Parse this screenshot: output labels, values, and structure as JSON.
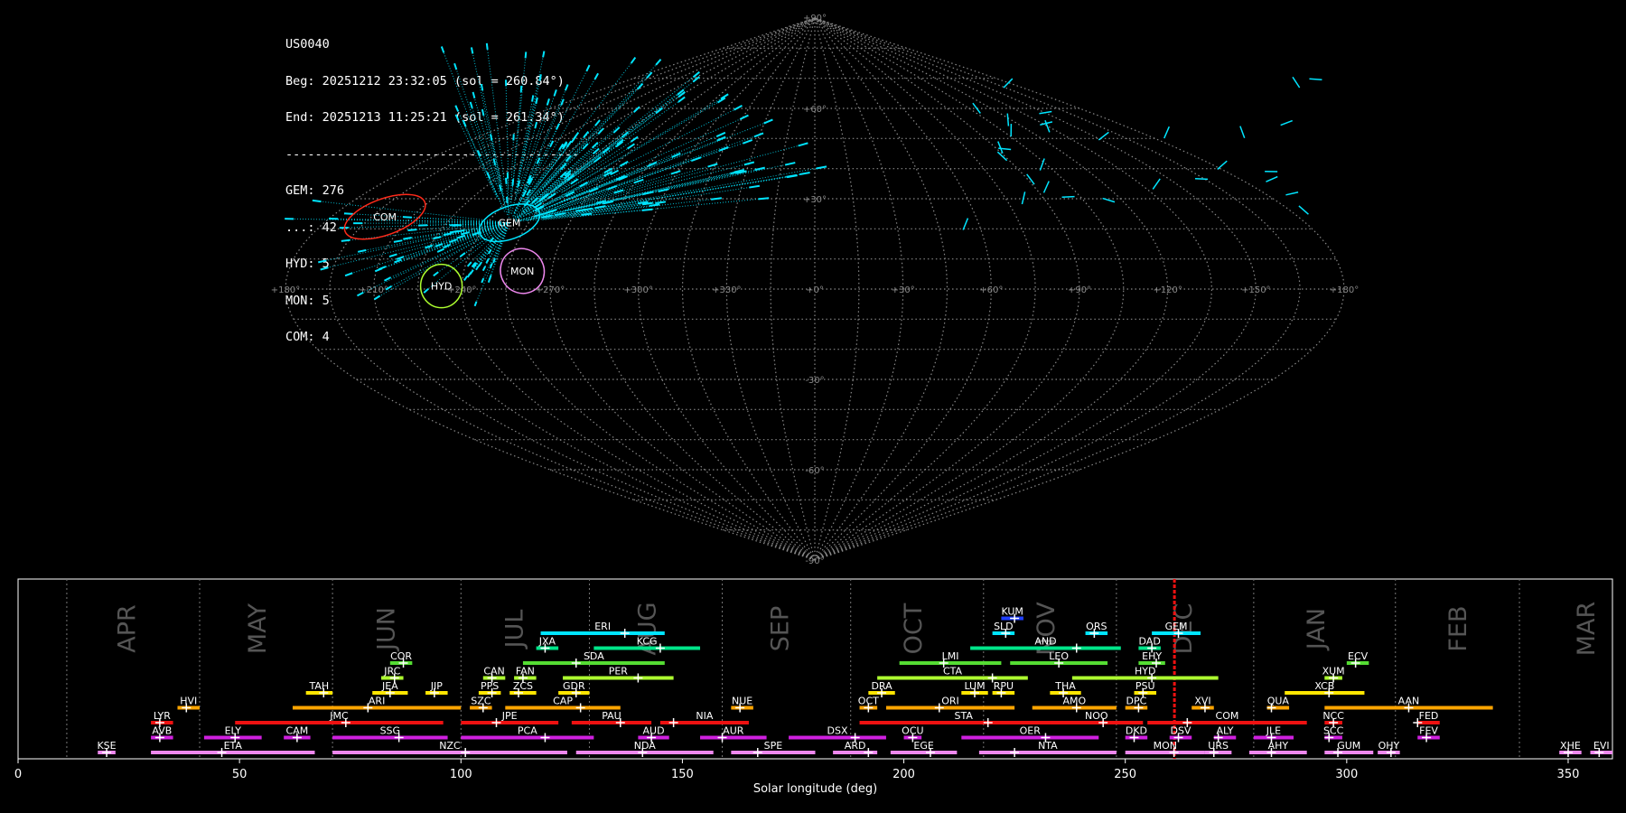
{
  "info": {
    "station": "US0040",
    "begin": "Beg: 20251212 23:32:05 (sol = 260.84°)",
    "end": "End: 20251213 11:25:21 (sol = 261.34°)",
    "separator": "----------------------------------------",
    "counts": [
      "GEM: 276",
      "...: 42",
      "HYD: 5",
      "MON: 5",
      "COM: 4"
    ]
  },
  "chart_data": [
    {
      "type": "scatter",
      "projection": "sinusoidal",
      "title": "",
      "grid": true,
      "ra_tick_labels": [
        "+180°",
        "+150°",
        "+120°",
        "+90°",
        "+60°",
        "+30°",
        "+0°",
        "+330°",
        "+300°",
        "+270°",
        "+240°",
        "+210°",
        "+180°"
      ],
      "dec_tick_labels": [
        "+90°",
        "+60°",
        "+30°",
        "-30°",
        "-60°",
        "-90°"
      ],
      "radiants": [
        {
          "name": "COM",
          "ra": 160,
          "dec": 24,
          "color": "#ff2a1a"
        },
        {
          "name": "GEM",
          "ra": 112,
          "dec": 22,
          "color": "#00e5ff"
        },
        {
          "name": "MON",
          "ra": 100,
          "dec": 6,
          "color": "#ee88ee"
        },
        {
          "name": "HYD",
          "ra": 127,
          "dec": 1,
          "color": "#adff2f"
        }
      ],
      "sporadic_color": "#00e5ff"
    },
    {
      "type": "bar",
      "orientation": "horizontal-ranges",
      "xlabel": "Solar longitude (deg)",
      "xlim": [
        0,
        360
      ],
      "x_ticks": [
        0,
        50,
        100,
        150,
        200,
        250,
        300,
        350
      ],
      "current_sol": 261.1,
      "months": [
        {
          "name": "APR",
          "pos": 24.5
        },
        {
          "name": "MAY",
          "pos": 54
        },
        {
          "name": "JUN",
          "pos": 83
        },
        {
          "name": "JUL",
          "pos": 112
        },
        {
          "name": "AUG",
          "pos": 142
        },
        {
          "name": "SEP",
          "pos": 172
        },
        {
          "name": "OCT",
          "pos": 202
        },
        {
          "name": "NOV",
          "pos": 232
        },
        {
          "name": "DEC",
          "pos": 263
        },
        {
          "name": "JAN",
          "pos": 293
        },
        {
          "name": "FEB",
          "pos": 325
        },
        {
          "name": "MAR",
          "pos": 354
        }
      ],
      "month_bounds": [
        11,
        41,
        71,
        100,
        129,
        159,
        188,
        218,
        248,
        279,
        311,
        339
      ],
      "showers": [
        {
          "name": "KUM",
          "start": 222,
          "end": 227,
          "peak": 225,
          "row": 9,
          "color": "#1f3fff"
        },
        {
          "name": "ERI",
          "start": 118,
          "end": 146,
          "peak": 137,
          "row": 8,
          "color": "#00e5ff"
        },
        {
          "name": "SLD",
          "start": 220,
          "end": 225,
          "peak": 223,
          "row": 8,
          "color": "#00e5ff"
        },
        {
          "name": "ORS",
          "start": 241,
          "end": 246,
          "peak": 243,
          "row": 8,
          "color": "#00e5ff"
        },
        {
          "name": "GEM",
          "start": 256,
          "end": 267,
          "peak": 262,
          "row": 8,
          "color": "#00e5ff"
        },
        {
          "name": "JXA",
          "start": 117,
          "end": 122,
          "peak": 119,
          "row": 7,
          "color": "#00e58a"
        },
        {
          "name": "KCG",
          "start": 130,
          "end": 154,
          "peak": 145,
          "row": 7,
          "color": "#00e58a"
        },
        {
          "name": "AND",
          "start": 215,
          "end": 249,
          "peak": 239,
          "row": 7,
          "color": "#00e58a"
        },
        {
          "name": "DAD",
          "start": 253,
          "end": 258,
          "peak": 256,
          "row": 7,
          "color": "#00e58a"
        },
        {
          "name": "COR",
          "start": 84,
          "end": 89,
          "peak": 87,
          "row": 6,
          "color": "#55dd33"
        },
        {
          "name": "SDA",
          "start": 114,
          "end": 146,
          "peak": 126,
          "row": 6,
          "color": "#55dd33"
        },
        {
          "name": "LMI",
          "start": 199,
          "end": 222,
          "peak": 209,
          "row": 6,
          "color": "#55dd33"
        },
        {
          "name": "LEO",
          "start": 224,
          "end": 246,
          "peak": 235,
          "row": 6,
          "color": "#55dd33"
        },
        {
          "name": "EHY",
          "start": 253,
          "end": 259,
          "peak": 257,
          "row": 6,
          "color": "#55dd33"
        },
        {
          "name": "ECV",
          "start": 300,
          "end": 305,
          "peak": 302,
          "row": 6,
          "color": "#55dd33"
        },
        {
          "name": "JRC",
          "start": 82,
          "end": 87,
          "peak": 85,
          "row": 5,
          "color": "#adff2f"
        },
        {
          "name": "CAN",
          "start": 105,
          "end": 110,
          "peak": 107,
          "row": 5,
          "color": "#adff2f"
        },
        {
          "name": "FAN",
          "start": 112,
          "end": 117,
          "peak": 114,
          "row": 5,
          "color": "#adff2f"
        },
        {
          "name": "PER",
          "start": 123,
          "end": 148,
          "peak": 140,
          "row": 5,
          "color": "#adff2f"
        },
        {
          "name": "CTA",
          "start": 194,
          "end": 228,
          "peak": 220,
          "row": 5,
          "color": "#adff2f"
        },
        {
          "name": "HYD",
          "start": 238,
          "end": 271,
          "peak": 256,
          "row": 5,
          "color": "#adff2f"
        },
        {
          "name": "XUM",
          "start": 295,
          "end": 299,
          "peak": 297,
          "row": 5,
          "color": "#adff2f"
        },
        {
          "name": "TAH",
          "start": 65,
          "end": 71,
          "peak": 69,
          "row": 4,
          "color": "#ffe600"
        },
        {
          "name": "JEA",
          "start": 80,
          "end": 88,
          "peak": 84,
          "row": 4,
          "color": "#ffe600"
        },
        {
          "name": "JIP",
          "start": 92,
          "end": 97,
          "peak": 94,
          "row": 4,
          "color": "#ffe600"
        },
        {
          "name": "PPS",
          "start": 104,
          "end": 109,
          "peak": 107,
          "row": 4,
          "color": "#ffe600"
        },
        {
          "name": "ZCS",
          "start": 111,
          "end": 117,
          "peak": 113,
          "row": 4,
          "color": "#ffe600"
        },
        {
          "name": "GDR",
          "start": 122,
          "end": 129,
          "peak": 126,
          "row": 4,
          "color": "#ffe600"
        },
        {
          "name": "DRA",
          "start": 192,
          "end": 198,
          "peak": 195,
          "row": 4,
          "color": "#ffe600"
        },
        {
          "name": "LUM",
          "start": 213,
          "end": 219,
          "peak": 216,
          "row": 4,
          "color": "#ffe600"
        },
        {
          "name": "RPU",
          "start": 220,
          "end": 225,
          "peak": 222,
          "row": 4,
          "color": "#ffe600"
        },
        {
          "name": "THA",
          "start": 233,
          "end": 240,
          "peak": 236,
          "row": 4,
          "color": "#ffe600"
        },
        {
          "name": "PSU",
          "start": 252,
          "end": 257,
          "peak": 254,
          "row": 4,
          "color": "#ffe600"
        },
        {
          "name": "XCB",
          "start": 286,
          "end": 304,
          "peak": 296,
          "row": 4,
          "color": "#ffe600"
        },
        {
          "name": "HVI",
          "start": 36,
          "end": 41,
          "peak": 38,
          "row": 3,
          "color": "#ffa500"
        },
        {
          "name": "ARI",
          "start": 62,
          "end": 100,
          "peak": 79,
          "row": 3,
          "color": "#ffa500"
        },
        {
          "name": "SZC",
          "start": 102,
          "end": 107,
          "peak": 105,
          "row": 3,
          "color": "#ffa500"
        },
        {
          "name": "CAP",
          "start": 110,
          "end": 136,
          "peak": 127,
          "row": 3,
          "color": "#ffa500"
        },
        {
          "name": "NUE",
          "start": 161,
          "end": 166,
          "peak": 163,
          "row": 3,
          "color": "#ffa500"
        },
        {
          "name": "OCT",
          "start": 190,
          "end": 194,
          "peak": 192,
          "row": 3,
          "color": "#ffa500"
        },
        {
          "name": "ORI",
          "start": 196,
          "end": 225,
          "peak": 208,
          "row": 3,
          "color": "#ffa500"
        },
        {
          "name": "AMO",
          "start": 229,
          "end": 248,
          "peak": 239,
          "row": 3,
          "color": "#ffa500"
        },
        {
          "name": "DPC",
          "start": 250,
          "end": 255,
          "peak": 253,
          "row": 3,
          "color": "#ffa500"
        },
        {
          "name": "XVI",
          "start": 265,
          "end": 270,
          "peak": 268,
          "row": 3,
          "color": "#ffa500"
        },
        {
          "name": "QUA",
          "start": 282,
          "end": 287,
          "peak": 283,
          "row": 3,
          "color": "#ffa500"
        },
        {
          "name": "AAN",
          "start": 295,
          "end": 333,
          "peak": 314,
          "row": 3,
          "color": "#ffa500"
        },
        {
          "name": "LYR",
          "start": 30,
          "end": 35,
          "peak": 32,
          "row": 2,
          "color": "#ee1111"
        },
        {
          "name": "JMC",
          "start": 49,
          "end": 96,
          "peak": 74,
          "row": 2,
          "color": "#ee1111"
        },
        {
          "name": "JPE",
          "start": 100,
          "end": 122,
          "peak": 108,
          "row": 2,
          "color": "#ee1111"
        },
        {
          "name": "PAU",
          "start": 125,
          "end": 143,
          "peak": 136,
          "row": 2,
          "color": "#ee1111"
        },
        {
          "name": "NIA",
          "start": 145,
          "end": 165,
          "peak": 148,
          "row": 2,
          "color": "#ee1111"
        },
        {
          "name": "STA",
          "start": 190,
          "end": 237,
          "peak": 219,
          "row": 2,
          "color": "#ee1111"
        },
        {
          "name": "NOO",
          "start": 233,
          "end": 254,
          "peak": 245,
          "row": 2,
          "color": "#ee1111"
        },
        {
          "name": "COM",
          "start": 255,
          "end": 291,
          "peak": 264,
          "row": 2,
          "color": "#ee1111"
        },
        {
          "name": "NCC",
          "start": 295,
          "end": 299,
          "peak": 297,
          "row": 2,
          "color": "#ee1111"
        },
        {
          "name": "FED",
          "start": 316,
          "end": 321,
          "peak": 316,
          "row": 2,
          "color": "#ee1111"
        },
        {
          "name": "AVB",
          "start": 30,
          "end": 35,
          "peak": 32,
          "row": 1,
          "color": "#d020e0"
        },
        {
          "name": "ELY",
          "start": 42,
          "end": 55,
          "peak": 49,
          "row": 1,
          "color": "#d020e0"
        },
        {
          "name": "CAM",
          "start": 60,
          "end": 66,
          "peak": 63,
          "row": 1,
          "color": "#d020e0"
        },
        {
          "name": "SSG",
          "start": 71,
          "end": 97,
          "peak": 86,
          "row": 1,
          "color": "#d020e0"
        },
        {
          "name": "PCA",
          "start": 100,
          "end": 130,
          "peak": 119,
          "row": 1,
          "color": "#d020e0"
        },
        {
          "name": "AUD",
          "start": 140,
          "end": 147,
          "peak": 143,
          "row": 1,
          "color": "#d020e0"
        },
        {
          "name": "AUR",
          "start": 154,
          "end": 169,
          "peak": 159,
          "row": 1,
          "color": "#d020e0"
        },
        {
          "name": "DSX",
          "start": 174,
          "end": 196,
          "peak": 189,
          "row": 1,
          "color": "#d020e0"
        },
        {
          "name": "OCU",
          "start": 200,
          "end": 204,
          "peak": 202,
          "row": 1,
          "color": "#d020e0"
        },
        {
          "name": "OER",
          "start": 213,
          "end": 244,
          "peak": 232,
          "row": 1,
          "color": "#d020e0"
        },
        {
          "name": "DKD",
          "start": 250,
          "end": 255,
          "peak": 252,
          "row": 1,
          "color": "#d020e0"
        },
        {
          "name": "DSV",
          "start": 260,
          "end": 265,
          "peak": 262,
          "row": 1,
          "color": "#d020e0"
        },
        {
          "name": "ALY",
          "start": 270,
          "end": 275,
          "peak": 271,
          "row": 1,
          "color": "#d020e0"
        },
        {
          "name": "JLE",
          "start": 279,
          "end": 288,
          "peak": 283,
          "row": 1,
          "color": "#d020e0"
        },
        {
          "name": "SCC",
          "start": 295,
          "end": 299,
          "peak": 296,
          "row": 1,
          "color": "#d020e0"
        },
        {
          "name": "FEV",
          "start": 316,
          "end": 321,
          "peak": 318,
          "row": 1,
          "color": "#d020e0"
        },
        {
          "name": "KSE",
          "start": 18,
          "end": 22,
          "peak": 20,
          "row": 0,
          "color": "#ee88ee"
        },
        {
          "name": "ETA",
          "start": 30,
          "end": 67,
          "peak": 46,
          "row": 0,
          "color": "#ee88ee"
        },
        {
          "name": "NZC",
          "start": 71,
          "end": 124,
          "peak": 101,
          "row": 0,
          "color": "#ee88ee"
        },
        {
          "name": "NDA",
          "start": 126,
          "end": 157,
          "peak": 141,
          "row": 0,
          "color": "#ee88ee"
        },
        {
          "name": "SPE",
          "start": 161,
          "end": 180,
          "peak": 167,
          "row": 0,
          "color": "#ee88ee"
        },
        {
          "name": "ARD",
          "start": 184,
          "end": 194,
          "peak": 192,
          "row": 0,
          "color": "#ee88ee"
        },
        {
          "name": "EGE",
          "start": 197,
          "end": 212,
          "peak": 206,
          "row": 0,
          "color": "#ee88ee"
        },
        {
          "name": "NTA",
          "start": 217,
          "end": 248,
          "peak": 225,
          "row": 0,
          "color": "#ee88ee"
        },
        {
          "name": "MON",
          "start": 250,
          "end": 268,
          "peak": 261,
          "row": 0,
          "color": "#ee88ee"
        },
        {
          "name": "URS",
          "start": 268,
          "end": 274,
          "peak": 270,
          "row": 0,
          "color": "#ee88ee"
        },
        {
          "name": "AHY",
          "start": 278,
          "end": 291,
          "peak": 283,
          "row": 0,
          "color": "#ee88ee"
        },
        {
          "name": "GUM",
          "start": 295,
          "end": 306,
          "peak": 298,
          "row": 0,
          "color": "#ee88ee"
        },
        {
          "name": "OHY",
          "start": 307,
          "end": 312,
          "peak": 310,
          "row": 0,
          "color": "#ee88ee"
        },
        {
          "name": "XHE",
          "start": 348,
          "end": 353,
          "peak": 350,
          "row": 0,
          "color": "#ee88ee"
        },
        {
          "name": "EVI",
          "start": 355,
          "end": 360,
          "peak": 357,
          "row": 0,
          "color": "#ee88ee"
        }
      ]
    }
  ]
}
